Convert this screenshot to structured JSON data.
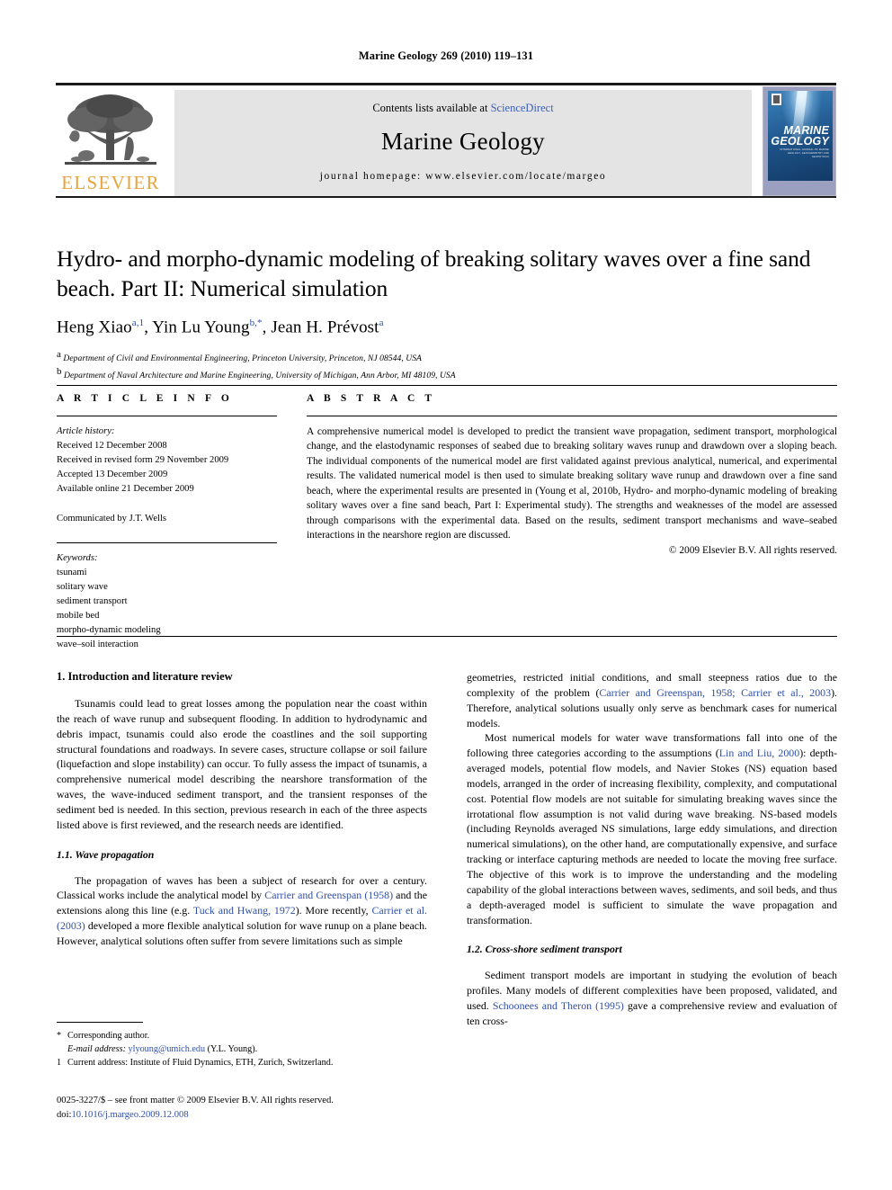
{
  "running_head": "Marine Geology 269 (2010) 119–131",
  "masthead": {
    "contents_prefix": "Contents lists available at ",
    "sciencedirect": "ScienceDirect",
    "journal_title": "Marine Geology",
    "homepage": "journal homepage: www.elsevier.com/locate/margeo",
    "publisher_name": "ELSEVIER",
    "cover": {
      "title_line1": "MARINE",
      "title_line2": "GEOLOGY",
      "subtitle": "INTERNATIONAL JOURNAL OF MARINE GEOLOGY, GEOCHEMISTRY AND GEOPHYSICS"
    }
  },
  "article": {
    "title": "Hydro- and morpho-dynamic modeling of breaking solitary waves over a fine sand beach. Part II: Numerical simulation",
    "authors": [
      {
        "name": "Heng Xiao",
        "marks": "a,1",
        "sep": ", "
      },
      {
        "name": "Yin Lu Young",
        "marks": "b,*",
        "sep": ", "
      },
      {
        "name": "Jean H. Prévost",
        "marks": "a",
        "sep": ""
      }
    ],
    "affiliations": [
      {
        "mark": "a",
        "text": "Department of Civil and Environmental Engineering, Princeton University, Princeton, NJ 08544, USA"
      },
      {
        "mark": "b",
        "text": "Department of Naval Architecture and Marine Engineering, University of Michigan, Ann Arbor, MI 48109, USA"
      }
    ]
  },
  "article_info": {
    "heading": "A R T I C L E    I N F O",
    "history_label": "Article history:",
    "history": [
      "Received 12 December 2008",
      "Received in revised form 29 November 2009",
      "Accepted 13 December 2009",
      "Available online 21 December 2009"
    ],
    "communicated_by": "Communicated by J.T. Wells",
    "keywords_label": "Keywords:",
    "keywords": [
      "tsunami",
      "solitary wave",
      "sediment transport",
      "mobile bed",
      "morpho-dynamic modeling",
      "wave–soil interaction"
    ]
  },
  "abstract": {
    "heading": "A B S T R A C T",
    "text": "A comprehensive numerical model is developed to predict the transient wave propagation, sediment transport, morphological change, and the elastodynamic responses of seabed due to breaking solitary waves runup and drawdown over a sloping beach. The individual components of the numerical model are first validated against previous analytical, numerical, and experimental results. The validated numerical model is then used to simulate breaking solitary wave runup and drawdown over a fine sand beach, where the experimental results are presented in (Young et al, 2010b, Hydro- and morpho-dynamic modeling of breaking solitary waves over a fine sand beach, Part I: Experimental study). The strengths and weaknesses of the model are assessed through comparisons with the experimental data. Based on the results, sediment transport mechanisms and wave–seabed interactions in the nearshore region are discussed.",
    "copyright": "© 2009 Elsevier B.V. All rights reserved."
  },
  "body": {
    "section1_heading": "1. Introduction and literature review",
    "p1_a": "Tsunamis could lead to great losses among the population near the coast within the reach of wave runup and subsequent flooding. In addition to hydrodynamic and debris impact, tsunamis could also erode the coastlines and the soil supporting structural foundations and roadways. In severe cases, structure collapse or soil failure (liquefaction and slope instability) can occur. To fully assess the impact of tsunamis, a comprehensive numerical model describing the nearshore transformation of the waves, the wave-induced sediment transport, and the transient responses of the sediment bed is needed. In this section, previous research in each of the three aspects listed above is first reviewed, and the research needs are identified.",
    "section11_heading": "1.1. Wave propagation",
    "p2_part1": "The propagation of waves has been a subject of research for over a century. Classical works include the analytical model by ",
    "p2_cite1": "Carrier and Greenspan (1958)",
    "p2_part2": " and the extensions along this line (e.g. ",
    "p2_cite2": "Tuck and Hwang, 1972",
    "p2_part3": "). More recently, ",
    "p2_cite3": "Carrier et al. (2003)",
    "p2_part4": " developed a more flexible analytical solution for wave runup on a plane beach. However, analytical solutions often suffer from severe limitations such as simple",
    "p3_part1": "geometries, restricted initial conditions, and small steepness ratios due to the complexity of the problem (",
    "p3_cite1": "Carrier and Greenspan, 1958; Carrier et al., 2003",
    "p3_part2": "). Therefore, analytical solutions usually only serve as benchmark cases for numerical models.",
    "p4_part1": "Most numerical models for water wave transformations fall into one of the following three categories according to the assumptions (",
    "p4_cite1": "Lin and Liu, 2000",
    "p4_part2": "): depth-averaged models, potential flow models, and Navier Stokes (NS) equation based models, arranged in the order of increasing flexibility, complexity, and computational cost. Potential flow models are not suitable for simulating breaking waves since the irrotational flow assumption is not valid during wave breaking. NS-based models (including Reynolds averaged NS simulations, large eddy simulations, and direction numerical simulations), on the other hand, are computationally expensive, and surface tracking or interface capturing methods are needed to locate the moving free surface. The objective of this work is to improve the understanding and the modeling capability of the global interactions between waves, sediments, and soil beds, and thus a depth-averaged model is sufficient to simulate the wave propagation and transformation.",
    "section12_heading": "1.2. Cross-shore sediment transport",
    "p5_part1": "Sediment transport models are important in studying the evolution of beach profiles. Many models of different complexities have been proposed, validated, and used. ",
    "p5_cite1": "Schoonees and Theron (1995)",
    "p5_part2": " gave a comprehensive review and evaluation of ten cross-"
  },
  "footnotes": {
    "corresponding_mark": "*",
    "corresponding_text": "Corresponding author.",
    "email_label": "E-mail address:",
    "email": "ylyoung@umich.edu",
    "email_suffix": "(Y.L. Young).",
    "note1_mark": "1",
    "note1_text": "Current address: Institute of Fluid Dynamics, ETH, Zurich, Switzerland.",
    "issn_line": "0025-3227/$ – see front matter © 2009 Elsevier B.V. All rights reserved.",
    "doi_label": "doi:",
    "doi_value": "10.1016/j.margeo.2009.12.008"
  },
  "colors": {
    "link_blue": "#2f4fa8",
    "sciencedirect_blue": "#3b5fbf",
    "elsevier_orange": "#e8a33d"
  }
}
